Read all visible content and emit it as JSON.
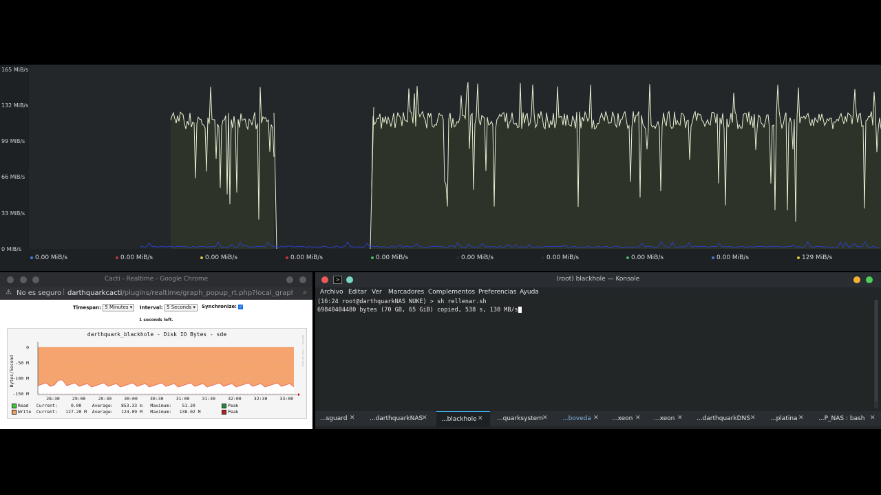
{
  "monitor": {
    "y_axis_labels": [
      "165 MiB/s",
      "132 MiB/s",
      "99 MiB/s",
      "66 MiB/s",
      "33 MiB/s",
      "0 MiB/s"
    ],
    "legend": [
      {
        "value": "0.00 MiB/s",
        "color": "#3b7dd8"
      },
      {
        "value": "0.00 MiB/s",
        "color": "#c8323c"
      },
      {
        "value": "0.00 MiB/s",
        "color": "#d8c23a"
      },
      {
        "value": "0.00 MiB/s",
        "color": "#c8323c"
      },
      {
        "value": "0.00 MiB/s",
        "color": "#3fbf5a"
      },
      {
        "value": "0.00 MiB/s",
        "color": "#2a2d30"
      },
      {
        "value": "0.00 MiB/s",
        "color": "#2a2d30"
      },
      {
        "value": "0.00 MiB/s",
        "color": "#3fbf5a"
      },
      {
        "value": "0.00 MiB/s",
        "color": "#3b7dd8"
      },
      {
        "value": "129 MiB/s",
        "color": "#d8c23a"
      }
    ],
    "line_color": "#e8f0d2",
    "fill_color": "#2d3328",
    "read_color": "#2a3fc8"
  },
  "chrome": {
    "window_title": "Cacti - Realtime - Google Chrome",
    "security_icon": "warning-icon",
    "security_text": "No es seguro",
    "url_host": "darthquarkcacti",
    "url_path": "/plugins/realtime/graph_popup_rt.php?local_graph_i...",
    "timespan_label": "Timespan:",
    "timespan_value": "5 Minutes",
    "interval_label": "Interval:",
    "interval_value": "5 Seconds",
    "sync_label": "Synchronize:",
    "seconds_left": "1 seconds left."
  },
  "cacti_graph": {
    "title": "darthquark_blackhole - Disk IO Bytes - sde",
    "ylabel": "Bytes/Second",
    "y_ticks": [
      "0",
      "-50 M",
      "-100 M",
      "-150 M"
    ],
    "x_ticks": [
      "28:30",
      "29:00",
      "29:30",
      "30:00",
      "30:30",
      "31:00",
      "31:30",
      "32:00",
      "32:30",
      "33:00"
    ],
    "side_text": "RRDTOOL / TOBI OETIKER",
    "fill_color": "#f4a46c",
    "line_color": "#d2141e",
    "legend_read": "Read   Current:     0.00    Average:   853.33 m   Maximum:    51.20",
    "legend_write": "Write  Current:   127.20 M  Average:   124.09 M   Maximum:   138.02 M",
    "peak_label": "Peak",
    "read_color": "#3cc83c",
    "write_color": "#e8a06a",
    "peak_read_color": "#1e8c3c",
    "peak_write_color": "#b41e1e"
  },
  "konsole": {
    "window_title": "(root) blackhole — Konsole",
    "menu": [
      "Archivo",
      "Editar",
      "Ver",
      "Marcadores",
      "Complementos",
      "Preferencias",
      "Ayuda"
    ],
    "line1": "(16:24 root@darthquarkNAS NUKE) > sh rellenar.sh",
    "line2": "69840404480 bytes (70 GB, 65 GiB) copied, 538 s, 130 MB/s",
    "tabs": [
      "...sguard",
      "...darthquarkNAS",
      "...blackhole",
      "...quarksystem",
      "...boveda",
      "...xeon",
      "...xeon",
      "...darthquarkDNS",
      "...platina",
      "...P_NAS : bash"
    ],
    "active_tab": 2
  }
}
